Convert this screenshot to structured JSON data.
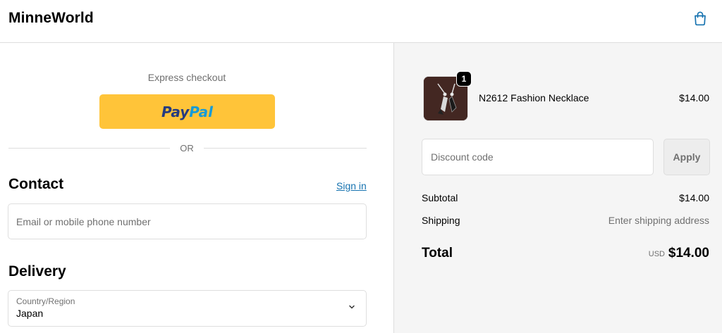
{
  "header": {
    "brand": "MinneWorld",
    "cart_icon": "shopping-bag-icon",
    "accent": "#1773b0"
  },
  "checkout": {
    "express_label": "Express checkout",
    "paypal_word_1": "Pay",
    "paypal_word_2": "Pal",
    "or_label": "OR",
    "contact": {
      "heading": "Contact",
      "sign_in": "Sign in",
      "email_placeholder": "Email or mobile phone number"
    },
    "delivery": {
      "heading": "Delivery",
      "country_label": "Country/Region",
      "country_value": "Japan"
    }
  },
  "summary": {
    "product": {
      "name": "N2612 Fashion Necklace",
      "price": "$14.00",
      "quantity": "1"
    },
    "discount_placeholder": "Discount code",
    "apply_label": "Apply",
    "subtotal_label": "Subtotal",
    "subtotal_value": "$14.00",
    "shipping_label": "Shipping",
    "shipping_value": "Enter shipping address",
    "total_label": "Total",
    "currency": "USD",
    "total_value": "$14.00"
  }
}
